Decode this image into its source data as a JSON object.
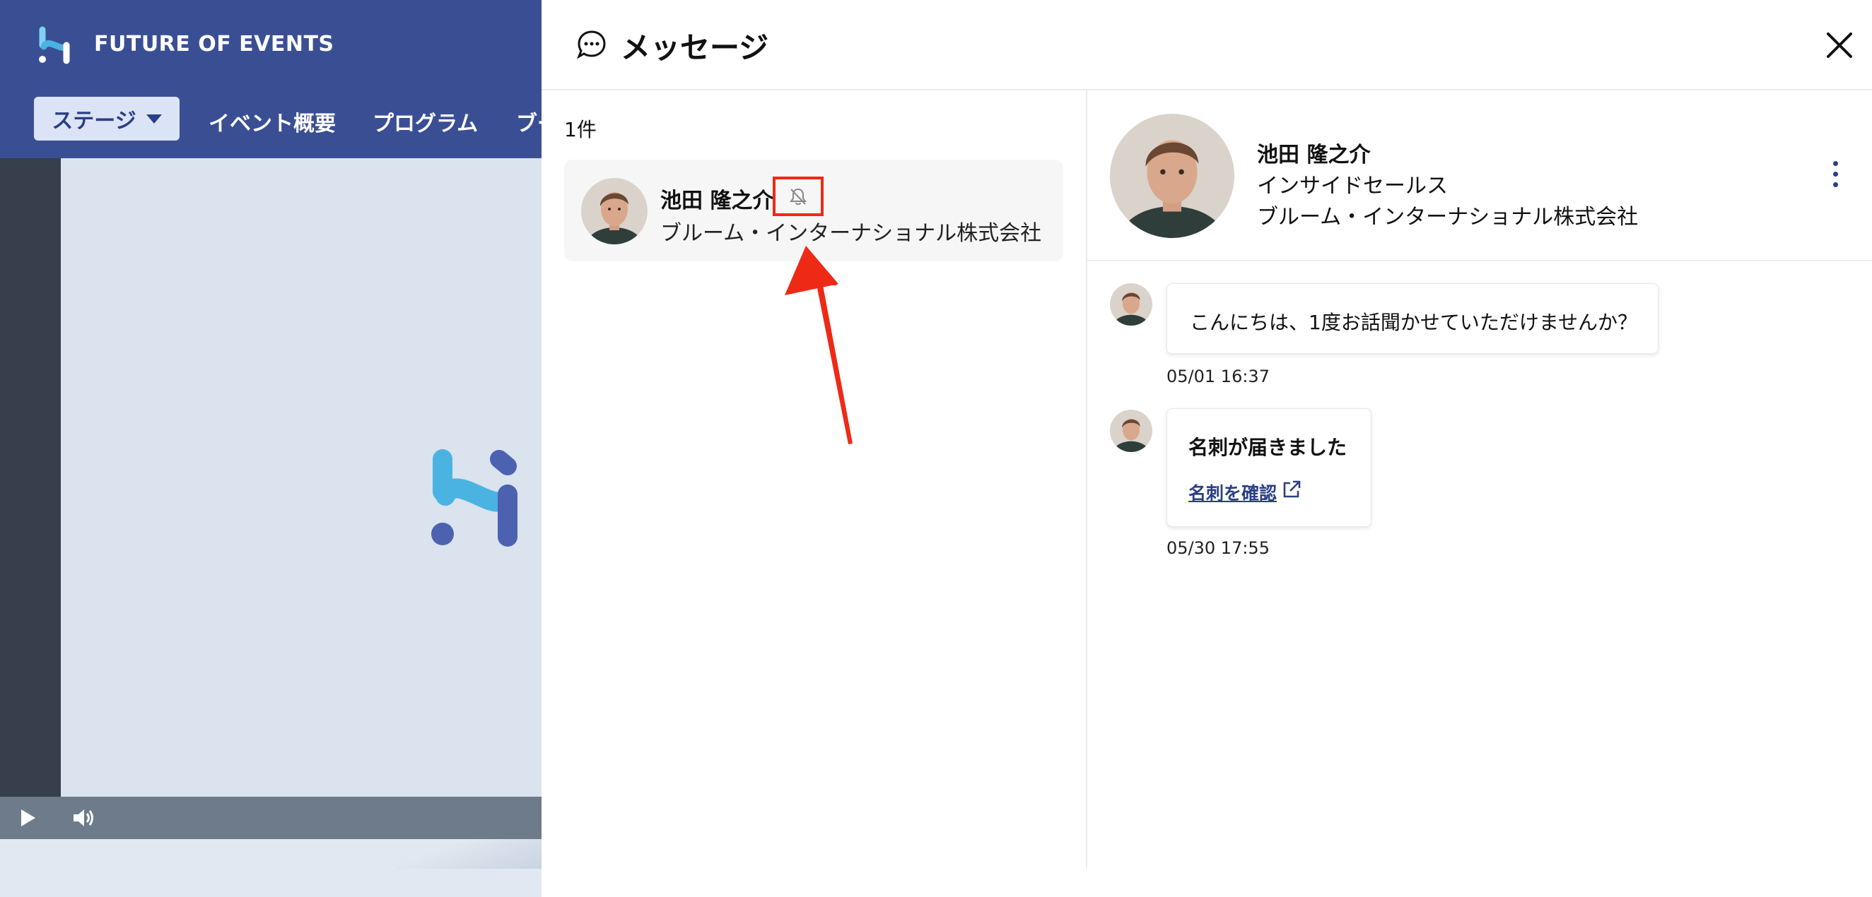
{
  "app": {
    "brand_name": "FUTURE OF EVENTS",
    "nav": {
      "stage_label": "ステージ",
      "overview_label": "イベント概要",
      "program_label": "プログラム",
      "booth_label": "ブー"
    }
  },
  "drawer": {
    "title": "メッセージ",
    "list": {
      "count_label": "1件",
      "contact": {
        "name": "池田 隆之介",
        "company": "ブルーム・インターナショナル株式会社"
      }
    },
    "profile": {
      "name": "池田 隆之介",
      "role": "インサイドセールス",
      "company": "ブルーム・インターナショナル株式会社"
    },
    "messages": [
      {
        "text": "こんにちは、1度お話聞かせていただけませんか？",
        "time": "05/01 16:37"
      },
      {
        "title": "名刺が届きました",
        "link_label": "名刺を確認",
        "time": "05/30 17:55"
      }
    ]
  },
  "icons": {
    "brand": "brand-logo-icon",
    "chat": "chat-bubble-icon",
    "close": "close-icon",
    "mute": "bell-off-icon",
    "more": "more-vertical-icon",
    "external": "external-link-icon",
    "play": "play-icon",
    "volume": "volume-icon"
  },
  "colors": {
    "header_bg": "#3a4f93",
    "accent": "#2c3f84",
    "annotation": "#ee2a16",
    "logo_light": "#4ab3e2",
    "logo_dark": "#4c62b0"
  }
}
